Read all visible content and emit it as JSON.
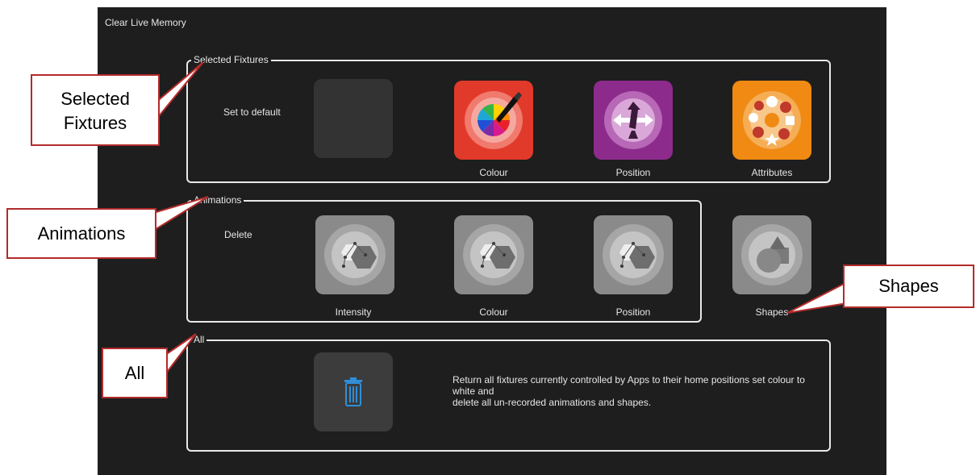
{
  "window": {
    "title": "Clear Live Memory"
  },
  "selected_fixtures": {
    "label": "Selected Fixtures",
    "instruction": "Set to default",
    "tiles": [
      {
        "icon": "blank",
        "caption": ""
      },
      {
        "icon": "colour-wheel-icon",
        "caption": "Colour",
        "color": "#e23a2a"
      },
      {
        "icon": "position-icon",
        "caption": "Position",
        "color": "#8d2b8c"
      },
      {
        "icon": "attributes-icon",
        "caption": "Attributes",
        "color": "#f08a12"
      }
    ]
  },
  "animations": {
    "label": "Animations",
    "instruction": "Delete",
    "tiles": [
      {
        "icon": "animation-icon",
        "caption": "Intensity"
      },
      {
        "icon": "animation-icon",
        "caption": "Colour"
      },
      {
        "icon": "animation-icon",
        "caption": "Position"
      },
      {
        "icon": "shapes-icon",
        "caption": "Shapes"
      }
    ]
  },
  "all": {
    "label": "All",
    "icon": "trash-icon",
    "description_line1": "Return all fixtures currently controlled by Apps to their home positions set colour to white and",
    "description_line2": "delete all un-recorded animations and shapes."
  },
  "callouts": {
    "selected_fixtures_line1": "Selected",
    "selected_fixtures_line2": "Fixtures",
    "animations": "Animations",
    "all": "All",
    "shapes": "Shapes"
  }
}
